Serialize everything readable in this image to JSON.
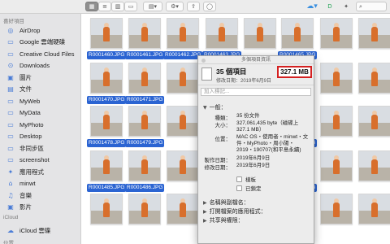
{
  "sidebar": {
    "favorites_header": "喜好項目",
    "items": [
      {
        "icon": "airdrop-icon",
        "glyph": "◎",
        "label": "AirDrop"
      },
      {
        "icon": "folder-icon",
        "glyph": "▭",
        "label": "Google 雲端硬碟"
      },
      {
        "icon": "folder-icon",
        "glyph": "▭",
        "label": "Creative Cloud Files"
      },
      {
        "icon": "download-icon",
        "glyph": "⊙",
        "label": "Downloads"
      },
      {
        "icon": "pictures-icon",
        "glyph": "▣",
        "label": "圖片"
      },
      {
        "icon": "document-icon",
        "glyph": "▤",
        "label": "文件"
      },
      {
        "icon": "folder-icon",
        "glyph": "▭",
        "label": "MyWeb"
      },
      {
        "icon": "folder-icon",
        "glyph": "▭",
        "label": "MyData"
      },
      {
        "icon": "folder-icon",
        "glyph": "▭",
        "label": "MyPhoto"
      },
      {
        "icon": "desktop-icon",
        "glyph": "▭",
        "label": "Desktop"
      },
      {
        "icon": "folder-icon",
        "glyph": "▭",
        "label": "非同步區"
      },
      {
        "icon": "folder-icon",
        "glyph": "▭",
        "label": "screenshot"
      },
      {
        "icon": "applications-icon",
        "glyph": "✦",
        "label": "應用程式"
      },
      {
        "icon": "home-icon",
        "glyph": "⌂",
        "label": "minwt"
      },
      {
        "icon": "music-icon",
        "glyph": "♫",
        "label": "音樂"
      },
      {
        "icon": "movies-icon",
        "glyph": "▣",
        "label": "影片"
      }
    ],
    "icloud_header": "iCloud",
    "icloud_items": [
      {
        "icon": "cloud-icon",
        "glyph": "☁",
        "label": "iCloud 雲碟"
      }
    ],
    "locations_header": "位置"
  },
  "grid": {
    "files": [
      {
        "name": "R0001460.JPG",
        "selected": true
      },
      {
        "name": "R0001461.JPG",
        "selected": true
      },
      {
        "name": "R0001462.JPG",
        "selected": true
      },
      {
        "name": "R0001463.JPG",
        "selected": true
      },
      {
        "name": "",
        "selected": false
      },
      {
        "name": "R0001465.JPG",
        "selected": true
      },
      {
        "name": "",
        "selected": false
      },
      {
        "name": "",
        "selected": false
      },
      {
        "name": "R0001470.JPG",
        "selected": true
      },
      {
        "name": "R0001471.JPG",
        "selected": true
      },
      {
        "name": "",
        "selected": false
      },
      {
        "name": "",
        "selected": false
      },
      {
        "name": "",
        "selected": false
      },
      {
        "name": "",
        "selected": false
      },
      {
        "name": "",
        "selected": false
      },
      {
        "name": "",
        "selected": false
      },
      {
        "name": "R0001478.JPG",
        "selected": true
      },
      {
        "name": "R0001479.JPG",
        "selected": true
      },
      {
        "name": "",
        "selected": false
      },
      {
        "name": "",
        "selected": false
      },
      {
        "name": "",
        "selected": false
      },
      {
        "name": "R0001483.JPG",
        "selected": true
      },
      {
        "name": "",
        "selected": false
      },
      {
        "name": "",
        "selected": false
      },
      {
        "name": "R0001485.JPG",
        "selected": true
      },
      {
        "name": "R0001486.JPG",
        "selected": true
      },
      {
        "name": "",
        "selected": false
      },
      {
        "name": "",
        "selected": false
      },
      {
        "name": "",
        "selected": false
      },
      {
        "name": "R0001490.JPG",
        "selected": true
      },
      {
        "name": "",
        "selected": false
      },
      {
        "name": "",
        "selected": false
      },
      {
        "name": "",
        "selected": false
      },
      {
        "name": "",
        "selected": false
      },
      {
        "name": "",
        "selected": false
      },
      {
        "name": "",
        "selected": false
      },
      {
        "name": "",
        "selected": false
      },
      {
        "name": "",
        "selected": false
      },
      {
        "name": "",
        "selected": false
      },
      {
        "name": "",
        "selected": false
      }
    ]
  },
  "info": {
    "window_title": "多個項目資訊",
    "title": "35 個項目",
    "subtitle": "修改日期：2019年6月9日",
    "size": "327.1 MB",
    "tags_placeholder": "加入標記...",
    "general_header": "一般：",
    "rows": [
      {
        "label": "種類：",
        "value": "35 份文件"
      },
      {
        "label": "大小：",
        "value": "327,061,435 byte（磁碟上 327.1 MB）"
      },
      {
        "label": "位置：",
        "value": "MAC OS・使用者・minwt・文件・MyPhoto・周小陽・2019・190707(和平島永續)"
      },
      {
        "label": "製作日期：",
        "value": "2019年6月9日"
      },
      {
        "label": "修改日期：",
        "value": "2019年6月9日"
      }
    ],
    "checkbox_stationery": "樣板",
    "checkbox_locked": "已鎖定",
    "section_name": "名稱與副檔名：",
    "section_open_with": "打開檔案的應用程式：",
    "section_sharing": "共享與權限："
  },
  "colors": {
    "selection": "#2b64d2",
    "highlight": "#d42020",
    "sidebar_bg": "#e4e4e6"
  }
}
